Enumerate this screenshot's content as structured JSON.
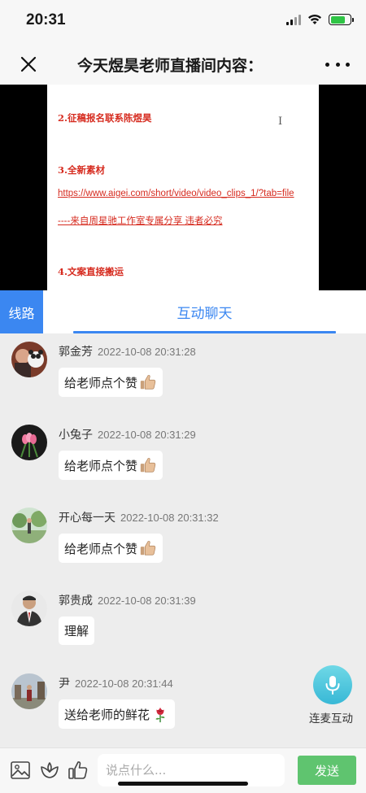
{
  "status_bar": {
    "time": "20:31",
    "battery_percent": 75,
    "battery_color": "#2fc445"
  },
  "nav": {
    "title": "今天煜昊老师直播间内容："
  },
  "video": {
    "lines": [
      "2.征稿报名联系陈煜昊",
      "3.全新素材",
      "https://www.aigei.com/short/video/video_clips_1/?tab=file",
      "----来自周星驰工作室专属分享          违者必究",
      "4.文案直接搬运"
    ],
    "cursor": "I"
  },
  "tabs": {
    "route": "线路",
    "chat": "互动聊天"
  },
  "messages": [
    {
      "name": "郭金芳",
      "time": "2022-10-08 20:31:28",
      "text": "给老师点个赞",
      "emoji": "thumbs-up"
    },
    {
      "name": "小兔子",
      "time": "2022-10-08 20:31:29",
      "text": "给老师点个赞",
      "emoji": "thumbs-up"
    },
    {
      "name": "开心每一天",
      "time": "2022-10-08 20:31:32",
      "text": "给老师点个赞",
      "emoji": "thumbs-up"
    },
    {
      "name": "郭贵成",
      "time": "2022-10-08 20:31:39",
      "text": "理解",
      "emoji": ""
    },
    {
      "name": "尹",
      "time": "2022-10-08 20:31:44",
      "text": "送给老师的鲜花",
      "emoji": "rose"
    }
  ],
  "mic": {
    "label": "连麦互动"
  },
  "composer": {
    "placeholder": "说点什么...",
    "send_label": "发送"
  },
  "colors": {
    "accent": "#3b87f1",
    "send": "#5fc46f",
    "slide_text": "#d62b1f"
  }
}
